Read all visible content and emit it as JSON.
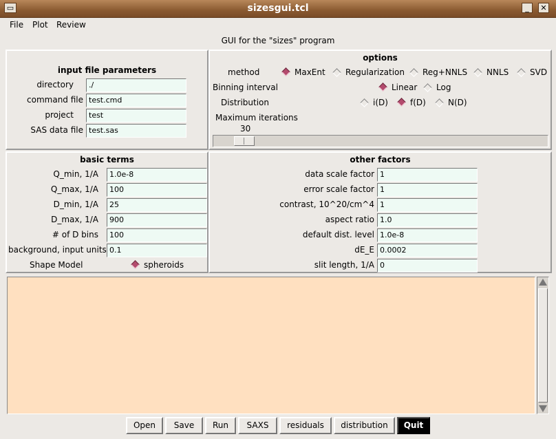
{
  "window": {
    "title": "sizesgui.tcl",
    "minimize": "_",
    "close": "✕"
  },
  "menubar": {
    "file": "File",
    "plot": "Plot",
    "review": "Review"
  },
  "caption": "GUI for the \"sizes\" program",
  "input": {
    "title": "input file parameters",
    "directory_label": "directory",
    "directory_value": "./",
    "command_label": "command file",
    "command_value": "test.cmd",
    "project_label": "project",
    "project_value": "test",
    "sas_label": "SAS data file",
    "sas_value": "test.sas"
  },
  "options": {
    "title": "options",
    "method_label": "method",
    "methods": [
      "MaxEnt",
      "Regularization",
      "Reg+NNLS",
      "NNLS",
      "SVD"
    ],
    "method_selected": "MaxEnt",
    "binning_label": "Binning interval",
    "binnings": [
      "Linear",
      "Log"
    ],
    "binning_selected": "Linear",
    "distribution_label": "Distribution",
    "distributions": [
      "i(D)",
      "f(D)",
      "N(D)"
    ],
    "distribution_selected": "f(D)",
    "iterations_label": "Maximum iterations",
    "iterations_value": "30",
    "iterations_level": 0.05
  },
  "basic": {
    "title": "basic terms",
    "qmin_label": "Q_min, 1/A",
    "qmin_value": "1.0e-8",
    "qmax_label": "Q_max, 1/A",
    "qmax_value": "100",
    "dmin_label": "D_min, 1/A",
    "dmin_value": "25",
    "dmax_label": "D_max, 1/A",
    "dmax_value": "900",
    "dbins_label": "# of D bins",
    "dbins_value": "100",
    "bg_label": "background, input units",
    "bg_value": "0.1",
    "shape_label": "Shape Model",
    "shape_value": "spheroids"
  },
  "other": {
    "title": "other factors",
    "dscale_label": "data scale factor",
    "dscale_value": "1",
    "escale_label": "error scale factor",
    "escale_value": "1",
    "contrast_label": "contrast, 10^20/cm^4",
    "contrast_value": "1",
    "aspect_label": "aspect ratio",
    "aspect_value": "1.0",
    "default_label": "default dist. level",
    "default_value": "1.0e-8",
    "de_label": "dE_E",
    "de_value": "0.0002",
    "slit_label": "slit length, 1/A",
    "slit_value": "0"
  },
  "buttons": {
    "open": "Open",
    "save": "Save",
    "run": "Run",
    "saxs": "SAXS",
    "residuals": "residuals",
    "distribution": "distribution",
    "quit": "Quit"
  },
  "colors": {
    "titlebar": "#8a5a31",
    "entry": "#eefaf4",
    "console": "#ffe0c0",
    "radio_on": "#b34b6d"
  }
}
